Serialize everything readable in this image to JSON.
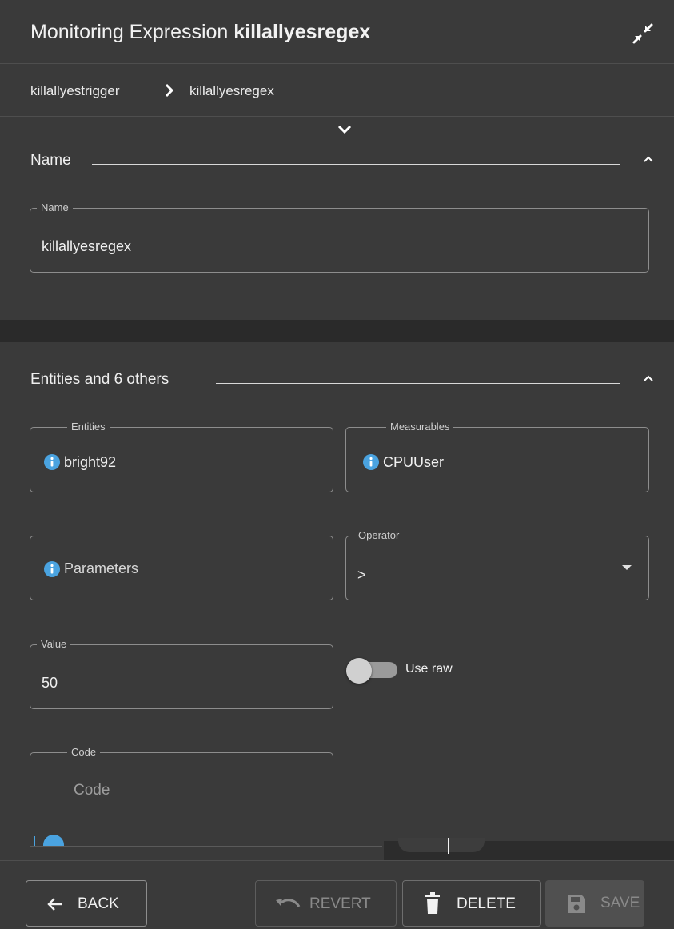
{
  "header": {
    "title_prefix": "Monitoring Expression",
    "title_name": "killallyesregex",
    "collapse_icon": "collapse-arrows-icon"
  },
  "breadcrumb": {
    "parent": "killallyestrigger",
    "current": "killallyesregex"
  },
  "name_section": {
    "title": "Name",
    "name_field": {
      "label": "Name",
      "value": "killallyesregex"
    }
  },
  "details_section": {
    "title": "Entities and 6 others",
    "entities": {
      "label": "Entities",
      "value": "bright92"
    },
    "measurables": {
      "label": "Measurables",
      "value": "CPUUser"
    },
    "parameters": {
      "placeholder": "Parameters"
    },
    "operator": {
      "label": "Operator",
      "value": ">"
    },
    "value_field": {
      "label": "Value",
      "value": "50"
    },
    "use_raw": {
      "label": "Use raw",
      "checked": false
    },
    "code": {
      "label": "Code",
      "placeholder": "Code"
    }
  },
  "footer": {
    "back": "BACK",
    "revert": "REVERT",
    "delete": "DELETE",
    "save": "SAVE"
  },
  "colors": {
    "background": "#3a3a3a",
    "info_blue": "#4aa3e0",
    "band": "#2a2a2a"
  }
}
